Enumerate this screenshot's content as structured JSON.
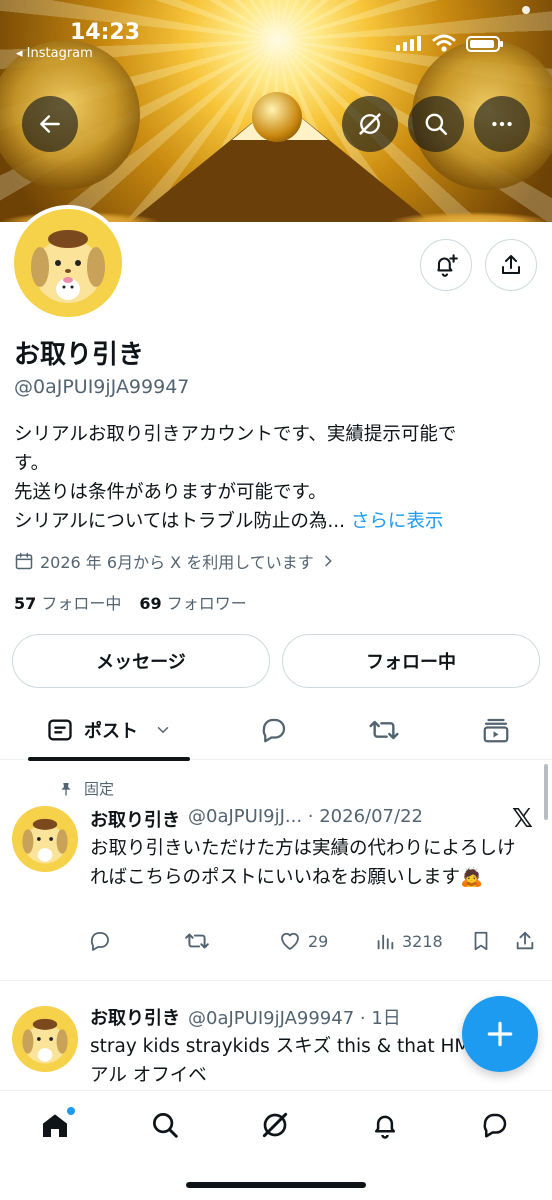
{
  "status_bar": {
    "time": "14:23",
    "back_app": "◂ Instagram"
  },
  "profile": {
    "name": "お取り引き",
    "handle": "@0aJPUI9jJA99947",
    "bio_lines": [
      "シリアルお取り引きアカウントです、実績提示可能で",
      "す。",
      "先送りは条件がありますが可能です。",
      "シリアルについてはトラブル防止の為... "
    ],
    "bio_more": "さらに表示",
    "joined": "2026 年 6月から X を利用しています",
    "following_count": "57",
    "following_label": "フォロー中",
    "followers_count": "69",
    "followers_label": "フォロワー",
    "message_button": "メッセージ",
    "following_button": "フォロー中"
  },
  "tabs": {
    "posts": "ポスト"
  },
  "pinned_label": "固定",
  "posts": [
    {
      "name": "お取り引き",
      "meta": "@0aJPUI9jJ... · 2026/07/22",
      "text": "お取り引きいただけた方は実績の代わりによろしければこちらのポストにいいねをお願いします🙇",
      "likes": "29",
      "views": "3218"
    },
    {
      "name": "お取り引き",
      "meta": "@0aJPUI9jJA99947 · 1日",
      "text": "stray kids straykids スキズ this & that HMV シリアル オフイベ"
    }
  ],
  "colors": {
    "accent": "#1d9bf0",
    "text": "#0f1419",
    "muted": "#536471",
    "avatar_bg": "#f6d24a"
  },
  "icons": [
    "back-arrow-icon",
    "grok-icon",
    "search-icon",
    "more-icon",
    "bell-plus-icon",
    "share-icon",
    "calendar-icon",
    "chevron-right-icon",
    "posts-icon",
    "chevron-down-icon",
    "reply-icon",
    "repost-icon",
    "media-icon",
    "pin-icon",
    "x-logo-icon",
    "heart-icon",
    "views-icon",
    "bookmark-icon",
    "plus-icon",
    "home-icon",
    "bell-icon",
    "messages-icon"
  ]
}
